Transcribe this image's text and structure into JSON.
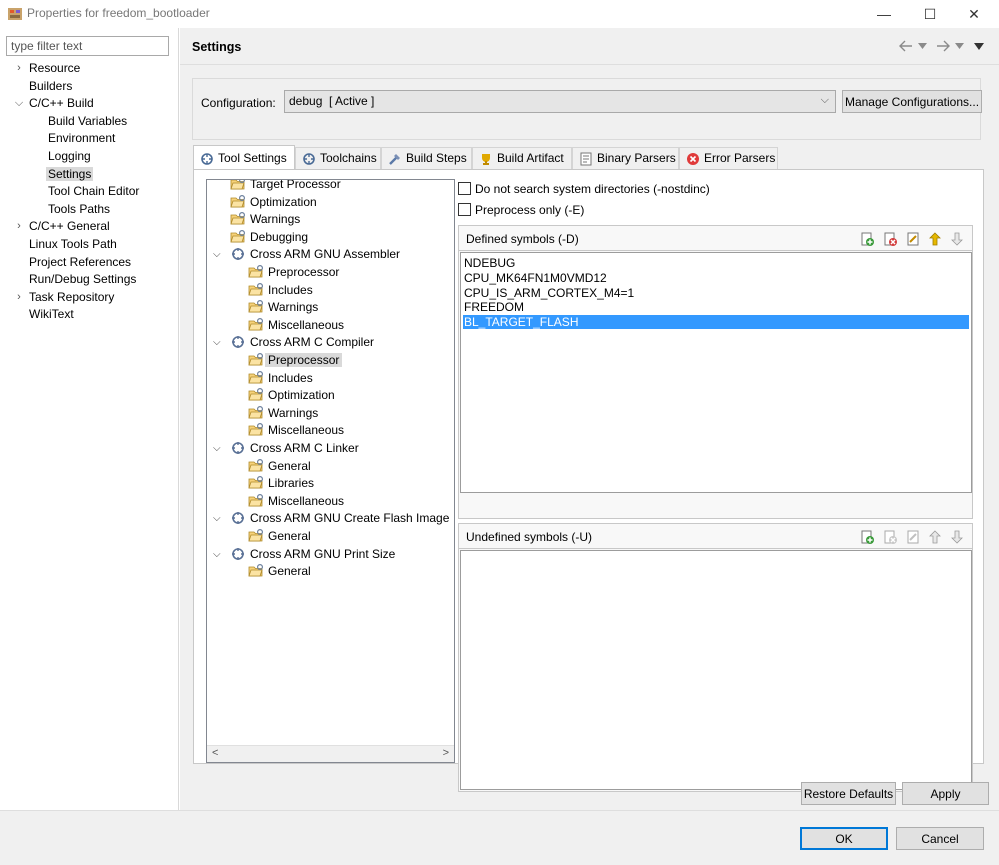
{
  "window": {
    "title": "Properties for freedom_bootloader",
    "minimize_glyph": "—",
    "maximize_glyph": "☐",
    "close_glyph": "✕"
  },
  "sidebar": {
    "filter_placeholder": "type filter text",
    "items": [
      {
        "label": "Resource",
        "expandable": true,
        "expanded": false
      },
      {
        "label": "Builders"
      },
      {
        "label": "C/C++ Build",
        "expandable": true,
        "expanded": true
      },
      {
        "label": "Build Variables"
      },
      {
        "label": "Environment"
      },
      {
        "label": "Logging"
      },
      {
        "label": "Settings",
        "selected": true
      },
      {
        "label": "Tool Chain Editor"
      },
      {
        "label": "Tools Paths"
      },
      {
        "label": "C/C++ General",
        "expandable": true,
        "expanded": false
      },
      {
        "label": "Linux Tools Path"
      },
      {
        "label": "Project References"
      },
      {
        "label": "Run/Debug Settings"
      },
      {
        "label": "Task Repository",
        "expandable": true,
        "expanded": false
      },
      {
        "label": "WikiText"
      }
    ]
  },
  "header": {
    "title": "Settings",
    "nav_icons": [
      "back-arrow-icon",
      "dropdown-icon",
      "forward-arrow-icon",
      "dropdown-icon",
      "view-menu-icon"
    ]
  },
  "configuration": {
    "label": "Configuration:",
    "selected": "debug  [ Active ]",
    "manage_button": "Manage Configurations..."
  },
  "tabs": [
    {
      "label": "Tool Settings",
      "icon": "tool-settings-icon",
      "active": true
    },
    {
      "label": "Toolchains",
      "icon": "toolchains-icon"
    },
    {
      "label": "Build Steps",
      "icon": "build-steps-icon"
    },
    {
      "label": "Build Artifact",
      "icon": "build-artifact-icon"
    },
    {
      "label": "Binary Parsers",
      "icon": "binary-parsers-icon"
    },
    {
      "label": "Error Parsers",
      "icon": "error-parsers-icon"
    }
  ],
  "tool_tree": [
    {
      "label": "Target Processor"
    },
    {
      "label": "Optimization"
    },
    {
      "label": "Warnings"
    },
    {
      "label": "Debugging"
    },
    {
      "label": "Cross ARM GNU Assembler",
      "tool": true
    },
    {
      "label": "Preprocessor"
    },
    {
      "label": "Includes"
    },
    {
      "label": "Warnings"
    },
    {
      "label": "Miscellaneous"
    },
    {
      "label": "Cross ARM C Compiler",
      "tool": true
    },
    {
      "label": "Preprocessor",
      "selected": true
    },
    {
      "label": "Includes"
    },
    {
      "label": "Optimization"
    },
    {
      "label": "Warnings"
    },
    {
      "label": "Miscellaneous"
    },
    {
      "label": "Cross ARM C Linker",
      "tool": true
    },
    {
      "label": "General"
    },
    {
      "label": "Libraries"
    },
    {
      "label": "Miscellaneous"
    },
    {
      "label": "Cross ARM GNU Create Flash Image",
      "tool": true
    },
    {
      "label": "General"
    },
    {
      "label": "Cross ARM GNU Print Size",
      "tool": true
    },
    {
      "label": "General"
    }
  ],
  "options": {
    "nostdinc_label": "Do not search system directories (-nostdinc)",
    "nostdinc_checked": false,
    "preprocess_label": "Preprocess only (-E)",
    "preprocess_checked": false
  },
  "defined_symbols": {
    "title": "Defined symbols (-D)",
    "items": [
      "NDEBUG",
      "CPU_MK64FN1M0VMD12",
      "CPU_IS_ARM_CORTEX_M4=1",
      "FREEDOM",
      "BL_TARGET_FLASH"
    ],
    "selected_index": 4
  },
  "undefined_symbols": {
    "title": "Undefined symbols (-U)",
    "items": []
  },
  "buttons": {
    "restore_defaults": "Restore Defaults",
    "apply": "Apply",
    "ok": "OK",
    "cancel": "Cancel"
  },
  "colors": {
    "selection_blue": "#3399ff",
    "dialog_gray": "#f0f0f0",
    "ok_border": "#0078d7"
  }
}
